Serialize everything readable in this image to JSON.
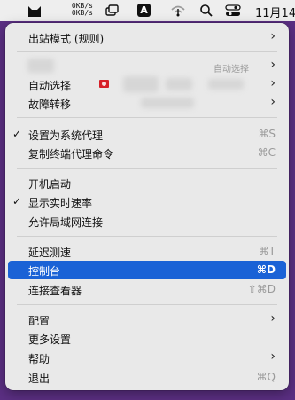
{
  "menubar": {
    "speed_up": "0KB/s",
    "speed_down": "0KB/s",
    "input_badge": "A",
    "date": "11月14"
  },
  "menu": {
    "outbound_mode": "出站模式 (规则)",
    "auto_select": "自动选择",
    "failover": "故障转移",
    "auto_select_hint": "自动选择",
    "set_system_proxy": "设置为系统代理",
    "set_system_proxy_sc": "⌘S",
    "copy_terminal_cmd": "复制终端代理命令",
    "copy_terminal_cmd_sc": "⌘C",
    "launch_at_login": "开机启动",
    "show_speed": "显示实时速率",
    "allow_lan": "允许局域网连接",
    "latency_test": "延迟测速",
    "latency_test_sc": "⌘T",
    "dashboard": "控制台",
    "dashboard_sc": "⌘D",
    "connections_viewer": "连接查看器",
    "connections_viewer_sc": "⇧⌘D",
    "config": "配置",
    "more_settings": "更多设置",
    "help": "帮助",
    "quit": "退出",
    "quit_sc": "⌘Q",
    "checkmark": "✓",
    "submenu_arrow": "›"
  },
  "colors": {
    "highlight": "#1a62d6",
    "desktop": "#5b2f83"
  },
  "icons": [
    "cat-icon",
    "window-icon",
    "wifi-icon",
    "search-icon",
    "control-center-icon"
  ]
}
